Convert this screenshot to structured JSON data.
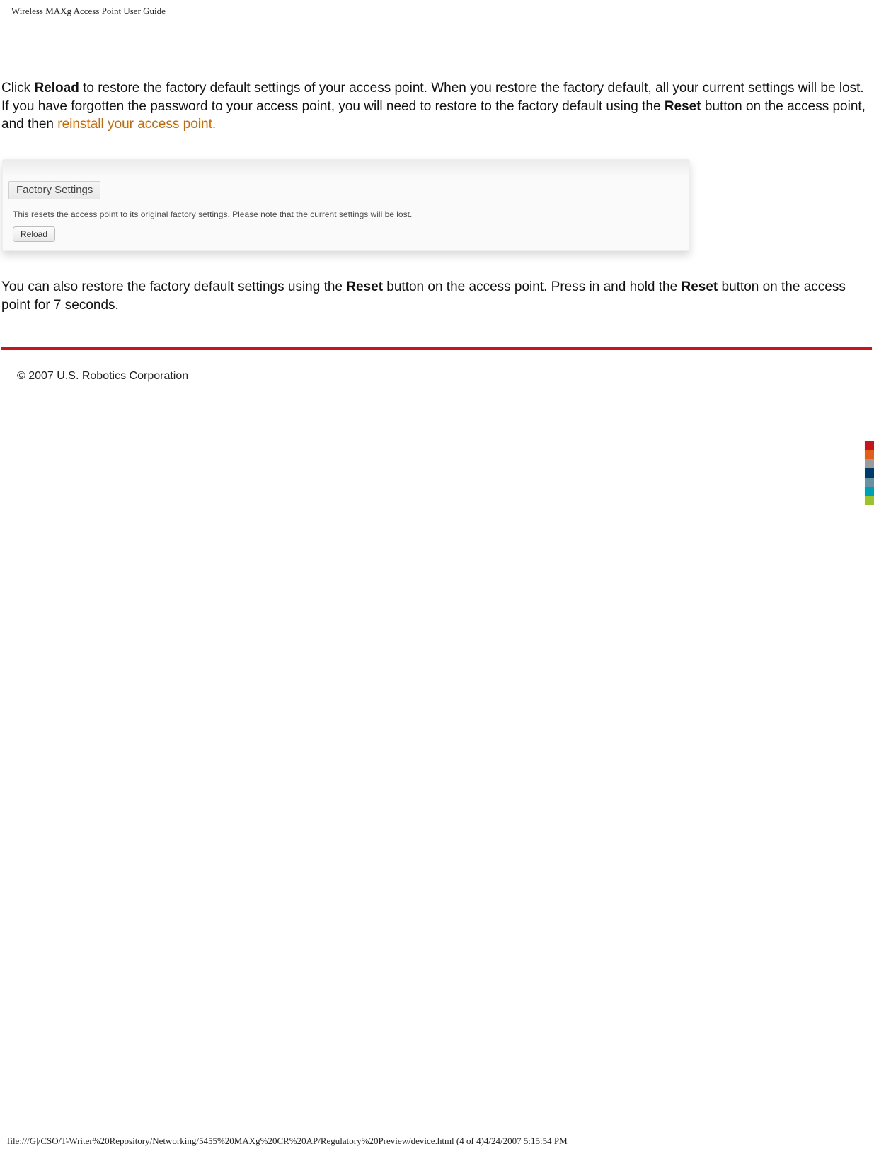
{
  "header": "Wireless MAXg Access Point User Guide",
  "p1": {
    "seg1": "Click ",
    "reload": "Reload",
    "seg2": " to restore the factory default settings of your access point. When you restore the factory default, all your current settings will be lost. If you have forgotten the password to your access point, you will need to restore to the factory default using the ",
    "reset": "Reset",
    "seg3": " button on the access point, and then ",
    "link": "reinstall your access point."
  },
  "panel": {
    "legend": "Factory Settings",
    "desc": "This resets the access point to its original factory settings. Please note that the current settings will be lost.",
    "button": "Reload"
  },
  "p2": {
    "seg1": "You can also restore the factory default settings using the ",
    "reset1": "Reset",
    "seg2": " button on the access point. Press in and hold the ",
    "reset2": "Reset",
    "seg3": " button on the access point for 7 seconds."
  },
  "copyright": "© 2007 U.S. Robotics Corporation",
  "color_stack": [
    "#c4161c",
    "#e25e1b",
    "#9b9b9b",
    "#003a6b",
    "#6a91a3",
    "#009fb4",
    "#9cc32b"
  ],
  "footer": "file:///G|/CSO/T-Writer%20Repository/Networking/5455%20MAXg%20CR%20AP/Regulatory%20Preview/device.html (4 of 4)4/24/2007 5:15:54 PM"
}
